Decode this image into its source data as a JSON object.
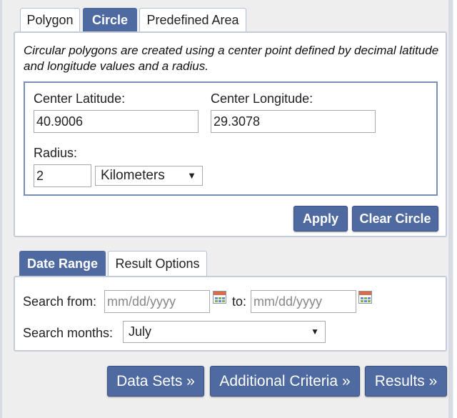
{
  "spatial_tabs": [
    {
      "label": "Polygon",
      "active": false
    },
    {
      "label": "Circle",
      "active": true
    },
    {
      "label": "Predefined Area",
      "active": false
    }
  ],
  "circle": {
    "description": "Circular polygons are created using a center point defined by decimal latitude and longitude values and a radius.",
    "center_latitude_label": "Center Latitude:",
    "center_latitude_value": "40.9006",
    "center_longitude_label": "Center Longitude:",
    "center_longitude_value": "29.3078",
    "radius_label": "Radius:",
    "radius_value": "2",
    "radius_unit": "Kilometers",
    "apply_label": "Apply",
    "clear_label": "Clear Circle"
  },
  "date_tabs": [
    {
      "label": "Date Range",
      "active": true
    },
    {
      "label": "Result Options",
      "active": false
    }
  ],
  "date_range": {
    "search_from_label": "Search from:",
    "from_placeholder": "mm/dd/yyyy",
    "to_label": "to:",
    "to_placeholder": "mm/dd/yyyy",
    "search_months_label": "Search months:",
    "months_value": "July"
  },
  "nav": {
    "data_sets": "Data Sets »",
    "additional_criteria": "Additional Criteria »",
    "results": "Results »"
  },
  "colors": {
    "accent": "#4e6aa1",
    "background": "#eeeeee",
    "border": "#c4cbdb"
  }
}
